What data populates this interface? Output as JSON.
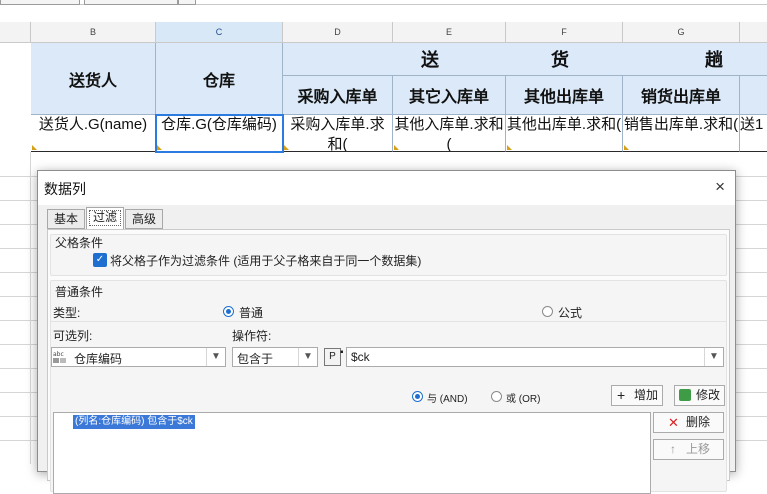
{
  "sheet": {
    "columns": [
      "B",
      "C",
      "D",
      "E",
      "F",
      "G"
    ],
    "group_header_chars": [
      "送",
      "货",
      "趟"
    ],
    "headers": {
      "deliverer": "送货人",
      "warehouse": "仓库",
      "purchase_in": "采购入库单",
      "other_in": "其它入库单",
      "other_out": "其他出库单",
      "sales_out": "销货出库单"
    },
    "cells": {
      "deliverer": "送货人.G(name)",
      "warehouse": "仓库.G(仓库编码)",
      "purchase_in": "采购入库单.求和(",
      "other_in": "其他入库单.求和(",
      "other_out": "其他出库单.求和(",
      "sales_out": "销售出库单.求和(",
      "overflow": "送1"
    }
  },
  "dialog": {
    "title": "数据列",
    "close_icon": "×",
    "tabs": [
      "基本",
      "过滤",
      "高级"
    ],
    "active_tab": "过滤",
    "parent_condition": {
      "label": "父格条件",
      "checkbox_label": "将父格子作为过滤条件 (适用于父子格来自于同一个数据集)",
      "checked": true
    },
    "normal_condition": {
      "label": "普通条件",
      "type_label": "类型:",
      "type_options": [
        "普通",
        "公式"
      ],
      "type_selected": "普通",
      "column_label": "可选列:",
      "column_value": "仓库编码",
      "operator_label": "操作符:",
      "operator_value": "包含于",
      "param_icon": "P",
      "value": "$ck",
      "logic_and": "与 (AND)",
      "logic_or": "或 (OR)",
      "logic_selected": "与 (AND)",
      "add_button": "增加",
      "modify_button": "修改",
      "delete_button": "删除",
      "up_button": "上移",
      "condition_items": [
        "(列名:仓库编码) 包含于$ck"
      ]
    }
  },
  "colors": {
    "header_fill": "#dbe9f8",
    "selection": "#2b7be0",
    "accent": "#1e6fd0"
  }
}
